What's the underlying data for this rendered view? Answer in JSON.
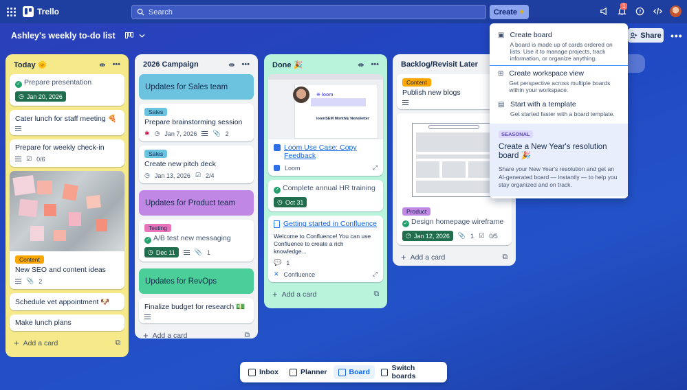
{
  "topbar": {
    "app_name": "Trello",
    "search_placeholder": "Search",
    "create_label": "Create",
    "notification_count": "1"
  },
  "board": {
    "title": "Ashley's weekly to-do list",
    "share_label": "Share"
  },
  "lists": {
    "today": {
      "title": "Today 🌞",
      "cards": {
        "c1": {
          "title": "Prepare presentation",
          "date": "Jan 20, 2026"
        },
        "c2": {
          "title": "Cater lunch for staff meeting 🍕"
        },
        "c3": {
          "title": "Prepare for weekly check-in",
          "checklist": "0/6"
        },
        "c4": {
          "label": "Content",
          "title": "New SEO and content ideas",
          "attachments": "2"
        },
        "c5": {
          "title": "Schedule vet appointment 🐶"
        },
        "c6": {
          "title": "Make lunch plans"
        }
      },
      "add_card": "Add a card"
    },
    "campaign": {
      "title": "2026 Campaign",
      "cards": {
        "h1": "Updates for Sales team",
        "c1": {
          "label": "Sales",
          "title": "Prepare brainstorming session",
          "date": "Jan 7, 2026",
          "attachments": "2"
        },
        "c2": {
          "label": "Sales",
          "title": "Create new pitch deck",
          "date": "Jan 13, 2026",
          "checklist": "2/4"
        },
        "h2": "Updates for Product team",
        "c3": {
          "label": "Testing",
          "title": "A/B test new messaging",
          "date": "Dec 11",
          "attachments": "1"
        },
        "h3": "Updates for RevOps",
        "c4": {
          "title": "Finalize budget for research 💵"
        }
      },
      "add_card": "Add a card"
    },
    "done": {
      "title": "Done 🎉",
      "cards": {
        "c1": {
          "title": "Loom Use Case: Copy Feedback",
          "source": "Loom",
          "preview_heading": "loomSEM Monthly Newsletter"
        },
        "c2": {
          "title": "Complete annual HR training",
          "date": "Oct 31"
        },
        "c3": {
          "title": "Getting started in Confluence",
          "body": "Welcome to Confluence! You can use Confluence to create a rich knowledge...",
          "comments": "1",
          "source": "Confluence"
        }
      },
      "add_card": "Add a card"
    },
    "backlog": {
      "title": "Backlog/Revisit Later",
      "cards": {
        "c1": {
          "label": "Content",
          "title": "Publish new blogs"
        },
        "c2": {
          "label": "Product",
          "title": "Design homepage wireframe",
          "date": "Jan 12, 2026",
          "attachments": "1",
          "checklist": "0/5"
        }
      },
      "add_card": "Add a card"
    }
  },
  "create_menu": {
    "items": [
      {
        "title": "Create board",
        "desc": "A board is made up of cards ordered on lists. Use it to manage projects, track information, or organize anything."
      },
      {
        "title": "Create workspace view",
        "desc": "Get perspective across multiple boards within your workspace."
      },
      {
        "title": "Start with a template",
        "desc": "Get started faster with a board template."
      }
    ],
    "seasonal": {
      "tag": "SEASONAL",
      "title": "Create a New Year's resolution board 🎉",
      "desc": "Share your New Year's resolution and get an AI-generated board — instantly — to help you stay organized and on track."
    }
  },
  "bottom_nav": {
    "inbox": "Inbox",
    "planner": "Planner",
    "board": "Board",
    "switch": "Switch boards"
  },
  "colors": {
    "today_list": "#f5e989",
    "campaign_list": "#f1f2f4",
    "done_list": "#baf3db",
    "backlog_list": "#f1f2f4",
    "sales_header": "#6cc3e0",
    "product_header": "#c087e5",
    "revops_header": "#4bce97",
    "label_content": "#fca700",
    "label_sales": "#6cc3e0",
    "label_testing": "#e774bb",
    "label_product": "#c087e5"
  }
}
